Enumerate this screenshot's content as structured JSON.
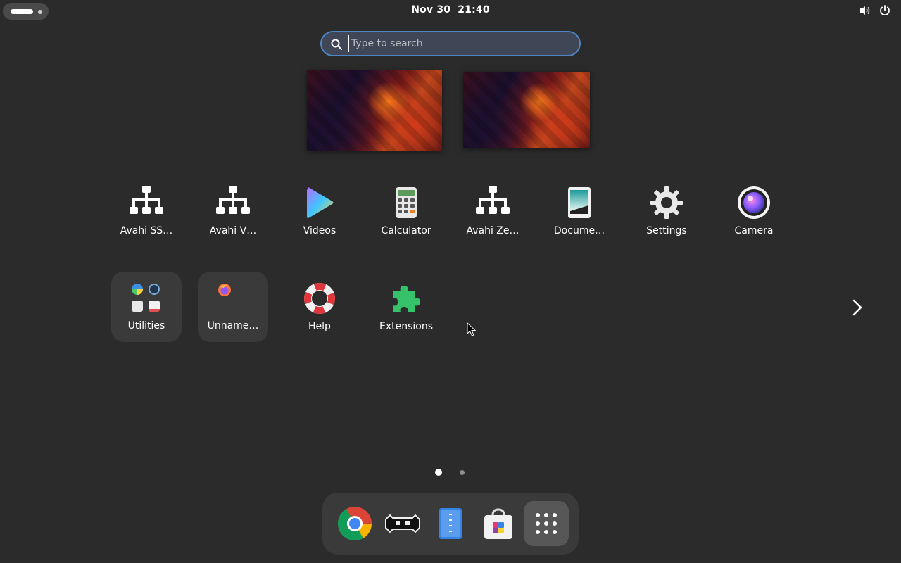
{
  "top_bar": {
    "date": "Nov 30",
    "time": "21:40",
    "icons": [
      "activities-indicator",
      "volume-icon",
      "power-icon"
    ]
  },
  "search": {
    "placeholder": "Type to search"
  },
  "apps": [
    {
      "label": "Avahi SS…",
      "icon": "network-icon"
    },
    {
      "label": "Avahi V…",
      "icon": "network-icon"
    },
    {
      "label": "Videos",
      "icon": "videos-icon"
    },
    {
      "label": "Calculator",
      "icon": "calculator-icon"
    },
    {
      "label": "Avahi Ze…",
      "icon": "network-icon"
    },
    {
      "label": "Docume…",
      "icon": "document-scanner-icon"
    },
    {
      "label": "Settings",
      "icon": "gear-icon"
    },
    {
      "label": "Camera",
      "icon": "camera-icon"
    }
  ],
  "folders": [
    {
      "label": "Utilities"
    },
    {
      "label": "Unname…"
    }
  ],
  "apps_row2": [
    {
      "label": "Help",
      "icon": "lifebuoy-icon"
    },
    {
      "label": "Extensions",
      "icon": "puzzle-icon"
    }
  ],
  "pager": {
    "pages": 2,
    "current": 1
  },
  "dash": {
    "items": [
      "chrome-icon",
      "retroarch-icon",
      "text-editor-icon",
      "software-store-icon",
      "show-apps-icon"
    ]
  },
  "colors": {
    "background": "#2b2b2b",
    "search_border": "#4f86c6",
    "folder_bg": "#3a3a3a",
    "dash_bg": "#3a3a3a"
  }
}
